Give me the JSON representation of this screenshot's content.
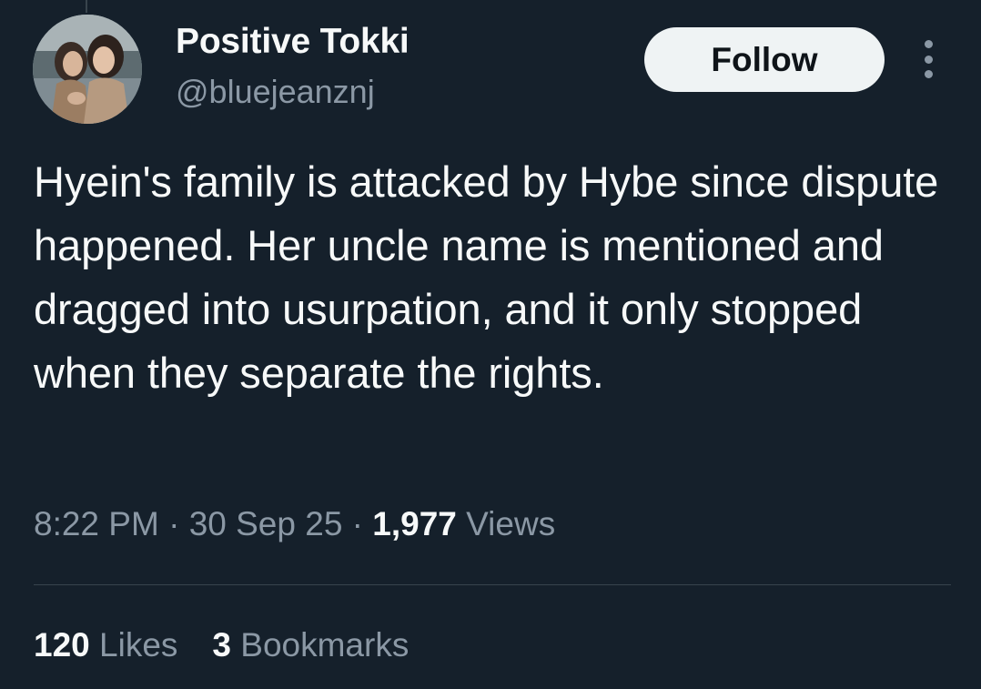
{
  "tweet": {
    "author": {
      "display_name": "Positive Tokki",
      "handle": "@bluejeanznj"
    },
    "follow_label": "Follow",
    "text": "Hyein's family is attacked by Hybe since dispute happened. Her uncle name is mentioned and dragged into usurpation, and it only stopped when they separate the rights.",
    "time": "8:22 PM",
    "separator": " · ",
    "date": "30 Sep 25",
    "views_count": "1,977",
    "views_label": "Views",
    "likes_count": "120",
    "likes_label": "Likes",
    "bookmarks_count": "3",
    "bookmarks_label": "Bookmarks"
  },
  "colors": {
    "background": "#15202b",
    "primary_text": "#f7f9f9",
    "secondary_text": "#8b98a5",
    "divider": "#38444d",
    "follow_button_bg": "#eff3f4"
  },
  "icons": {
    "more": "more-vertical-icon",
    "avatar": "profile-photo"
  }
}
